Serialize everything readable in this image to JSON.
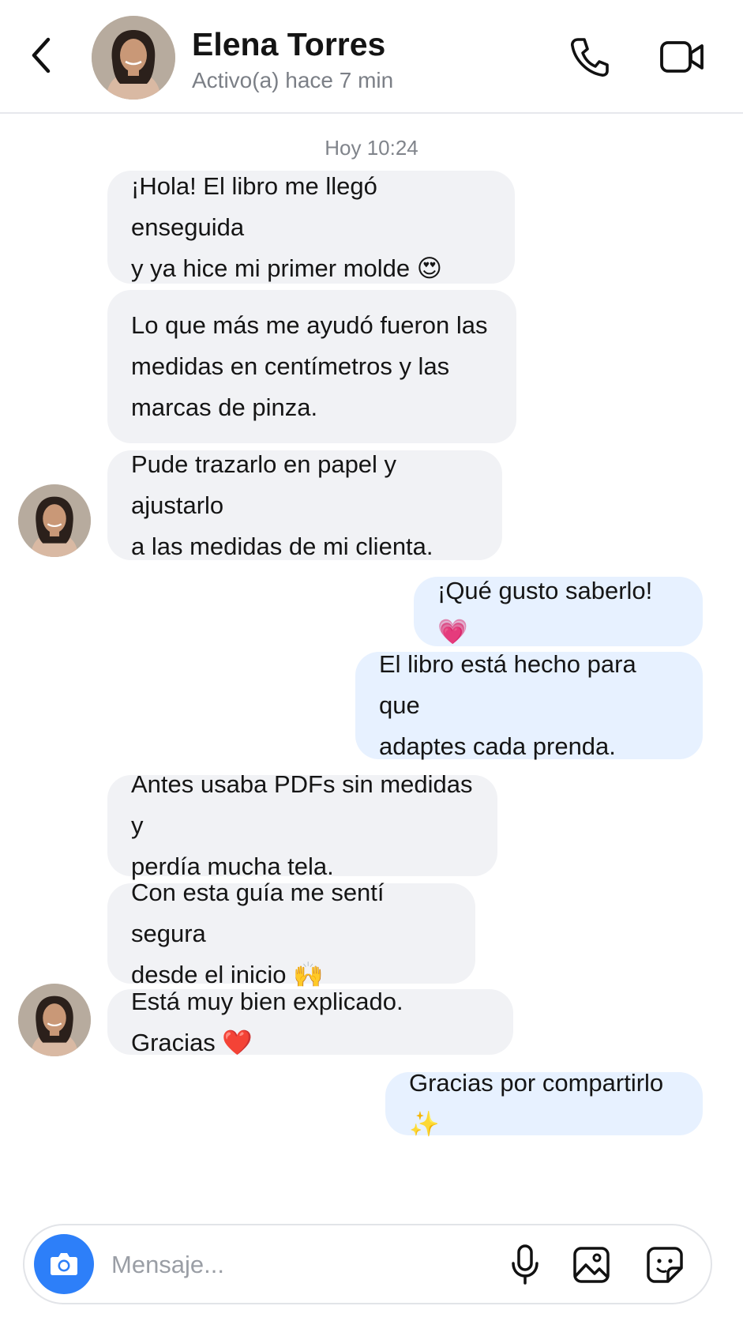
{
  "header": {
    "contact_name": "Elena Torres",
    "status": "Activo(a) hace 7 min",
    "back_icon": "chevron-left-icon",
    "call_icon": "phone-icon",
    "video_icon": "video-camera-icon"
  },
  "conversation": {
    "timestamp": "Hoy 10:24",
    "messages": [
      {
        "direction": "incoming",
        "lines": [
          "¡Hola! El libro me llegó enseguida",
          "y ya hice mi primer molde 😍"
        ]
      },
      {
        "direction": "incoming",
        "lines": [
          "Lo que más me ayudó fueron las",
          "medidas en centímetros y las",
          "marcas de pinza."
        ]
      },
      {
        "direction": "incoming",
        "lines": [
          "Pude trazarlo en papel y ajustarlo",
          "a las medidas de mi clienta."
        ]
      },
      {
        "direction": "outgoing",
        "lines": [
          "¡Qué gusto saberlo! 💗"
        ]
      },
      {
        "direction": "outgoing",
        "lines": [
          "El libro está hecho para que",
          "adaptes cada prenda."
        ]
      },
      {
        "direction": "incoming",
        "lines": [
          "Antes usaba PDFs sin medidas y",
          "perdía mucha tela."
        ]
      },
      {
        "direction": "incoming",
        "lines": [
          "Con esta guía me sentí segura",
          "desde el inicio 🙌"
        ]
      },
      {
        "direction": "incoming",
        "lines": [
          "Está muy bien explicado. Gracias ❤️"
        ]
      },
      {
        "direction": "outgoing",
        "lines": [
          "Gracias por compartirlo ✨"
        ]
      }
    ]
  },
  "composer": {
    "placeholder": "Mensaje...",
    "camera_icon": "camera-icon",
    "mic_icon": "microphone-icon",
    "gallery_icon": "image-icon",
    "sticker_icon": "sticker-icon"
  },
  "colors": {
    "incoming_bubble": "#f1f2f5",
    "outgoing_bubble": "#e7f1ff",
    "accent": "#2d7ff9",
    "status_text": "#7b7f86"
  }
}
